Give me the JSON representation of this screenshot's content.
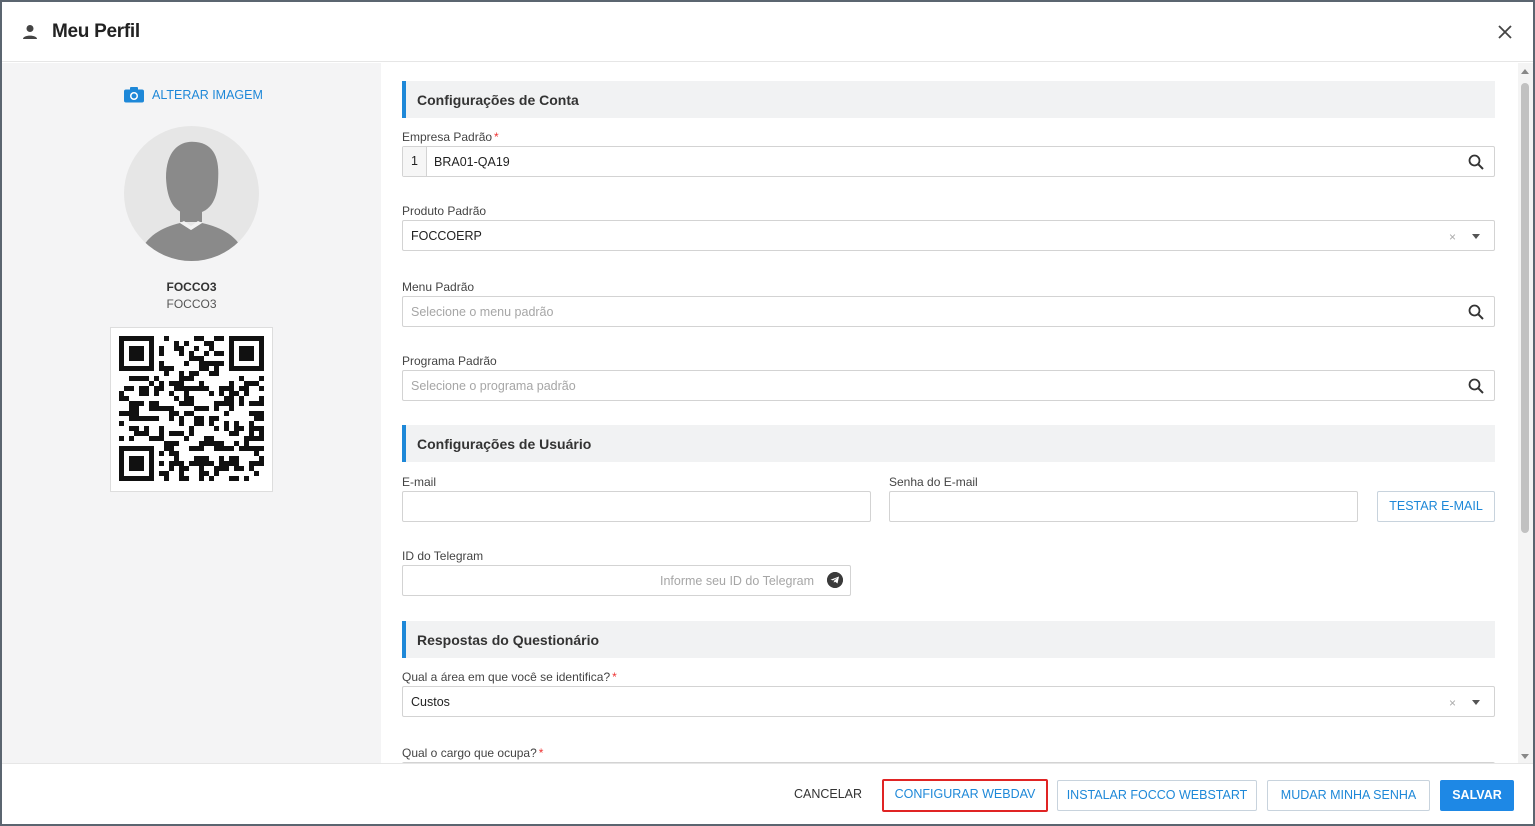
{
  "header": {
    "title": "Meu Perfil",
    "user_icon": "user-icon",
    "close_icon": "close-icon"
  },
  "profile": {
    "change_image_label": "ALTERAR IMAGEM",
    "username": "FOCCO3",
    "display_name": "FOCCO3"
  },
  "account": {
    "section_title": "Configurações de Conta",
    "company_label": "Empresa Padrão",
    "company_code": "1",
    "company_value": "BRA01-QA19",
    "product_label": "Produto Padrão",
    "product_value": "FOCCOERP",
    "menu_label": "Menu Padrão",
    "menu_placeholder": "Selecione o menu padrão",
    "program_label": "Programa Padrão",
    "program_placeholder": "Selecione o programa padrão"
  },
  "user": {
    "section_title": "Configurações de Usuário",
    "email_label": "E-mail",
    "email_value": "",
    "email_password_label": "Senha do E-mail",
    "email_password_value": "",
    "test_email_label": "TESTAR E-MAIL",
    "telegram_label": "ID do Telegram",
    "telegram_placeholder": "Informe seu ID do Telegram"
  },
  "questionnaire": {
    "section_title": "Respostas do Questionário",
    "area_label": "Qual a área em que você se identifica?",
    "area_value": "Custos",
    "role_label": "Qual o cargo que ocupa?"
  },
  "footer": {
    "cancel": "CANCELAR",
    "configure_webdav": "CONFIGURAR WEBDAV",
    "install_webstart": "INSTALAR FOCCO WEBSTART",
    "change_password": "MUDAR MINHA SENHA",
    "save": "SALVAR"
  },
  "colors": {
    "accent": "#1e88e5",
    "highlight_border": "#e02424",
    "required": "#e33333"
  },
  "required_marker": "*",
  "clear_marker": "×"
}
